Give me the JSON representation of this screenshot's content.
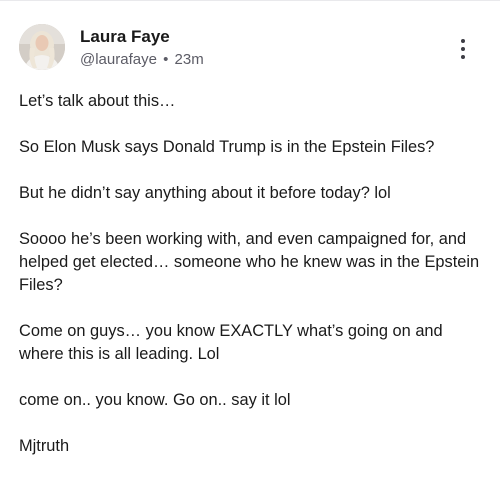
{
  "post": {
    "author": {
      "display_name": "Laura Faye",
      "handle": "@laurafaye",
      "separator": "•",
      "time_ago": "23m",
      "avatar_icon": "profile-photo-icon"
    },
    "menu_icon": "more-vertical-icon",
    "paragraphs": [
      "Let’s talk about this…",
      "So Elon Musk says Donald Trump is in the Epstein Files?",
      "But he didn’t say anything about it before today? lol",
      "Soooo he’s been working with, and even campaigned for, and helped get elected… someone who he knew was in the Epstein Files?",
      "Come on guys… you know EXACTLY what’s going on and where this is all leading. Lol",
      "come on.. you know. Go on.. say it lol",
      "Mjtruth"
    ]
  },
  "colors": {
    "text_primary": "#1a1a1a",
    "text_secondary": "#5c5c66",
    "divider": "#e9e9ec",
    "background": "#ffffff"
  }
}
